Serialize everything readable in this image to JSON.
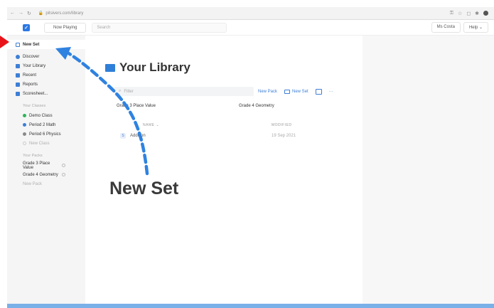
{
  "browser": {
    "url": "pitsivers.com/library"
  },
  "topbar": {
    "now_playing": "Now Playing",
    "search_placeholder": "Search",
    "account": "Ms Costa",
    "help": "Help"
  },
  "sidebar": {
    "items": [
      {
        "label": "New Set"
      },
      {
        "label": "Discover"
      },
      {
        "label": "Your Library"
      },
      {
        "label": "Recent"
      },
      {
        "label": "Reports"
      },
      {
        "label": "Scoresheet..."
      }
    ],
    "classes_header": "Your Classes",
    "classes": [
      {
        "label": "Demo Class",
        "color": "#2fb457"
      },
      {
        "label": "Period 2 Math",
        "color": "#3d7fd6"
      },
      {
        "label": "Period 6 Physics",
        "color": "#8a8a8a"
      }
    ],
    "new_class": "New Class",
    "packs_header": "Your Packs",
    "packs": [
      {
        "label": "Grade 3 Place Value"
      },
      {
        "label": "Grade 4 Geometry"
      }
    ],
    "new_pack": "New Pack"
  },
  "main": {
    "title": "Your Library",
    "filter_placeholder": "Filter",
    "new_pack": "New Pack",
    "new_set": "New Set",
    "more": "···",
    "pack_tabs": [
      "Grade 3 Place Value",
      "Grade 4 Geometry"
    ],
    "columns": [
      "NAME",
      "MODIFIED"
    ],
    "rows": [
      {
        "badge": "S",
        "name": "Addition",
        "modified": "19 Sep 2021"
      }
    ]
  },
  "annotation": {
    "label": "New Set"
  },
  "colors": {
    "accent": "#3d7fd6",
    "arrow": "#2f82e0",
    "pointer": "#e8141a"
  }
}
